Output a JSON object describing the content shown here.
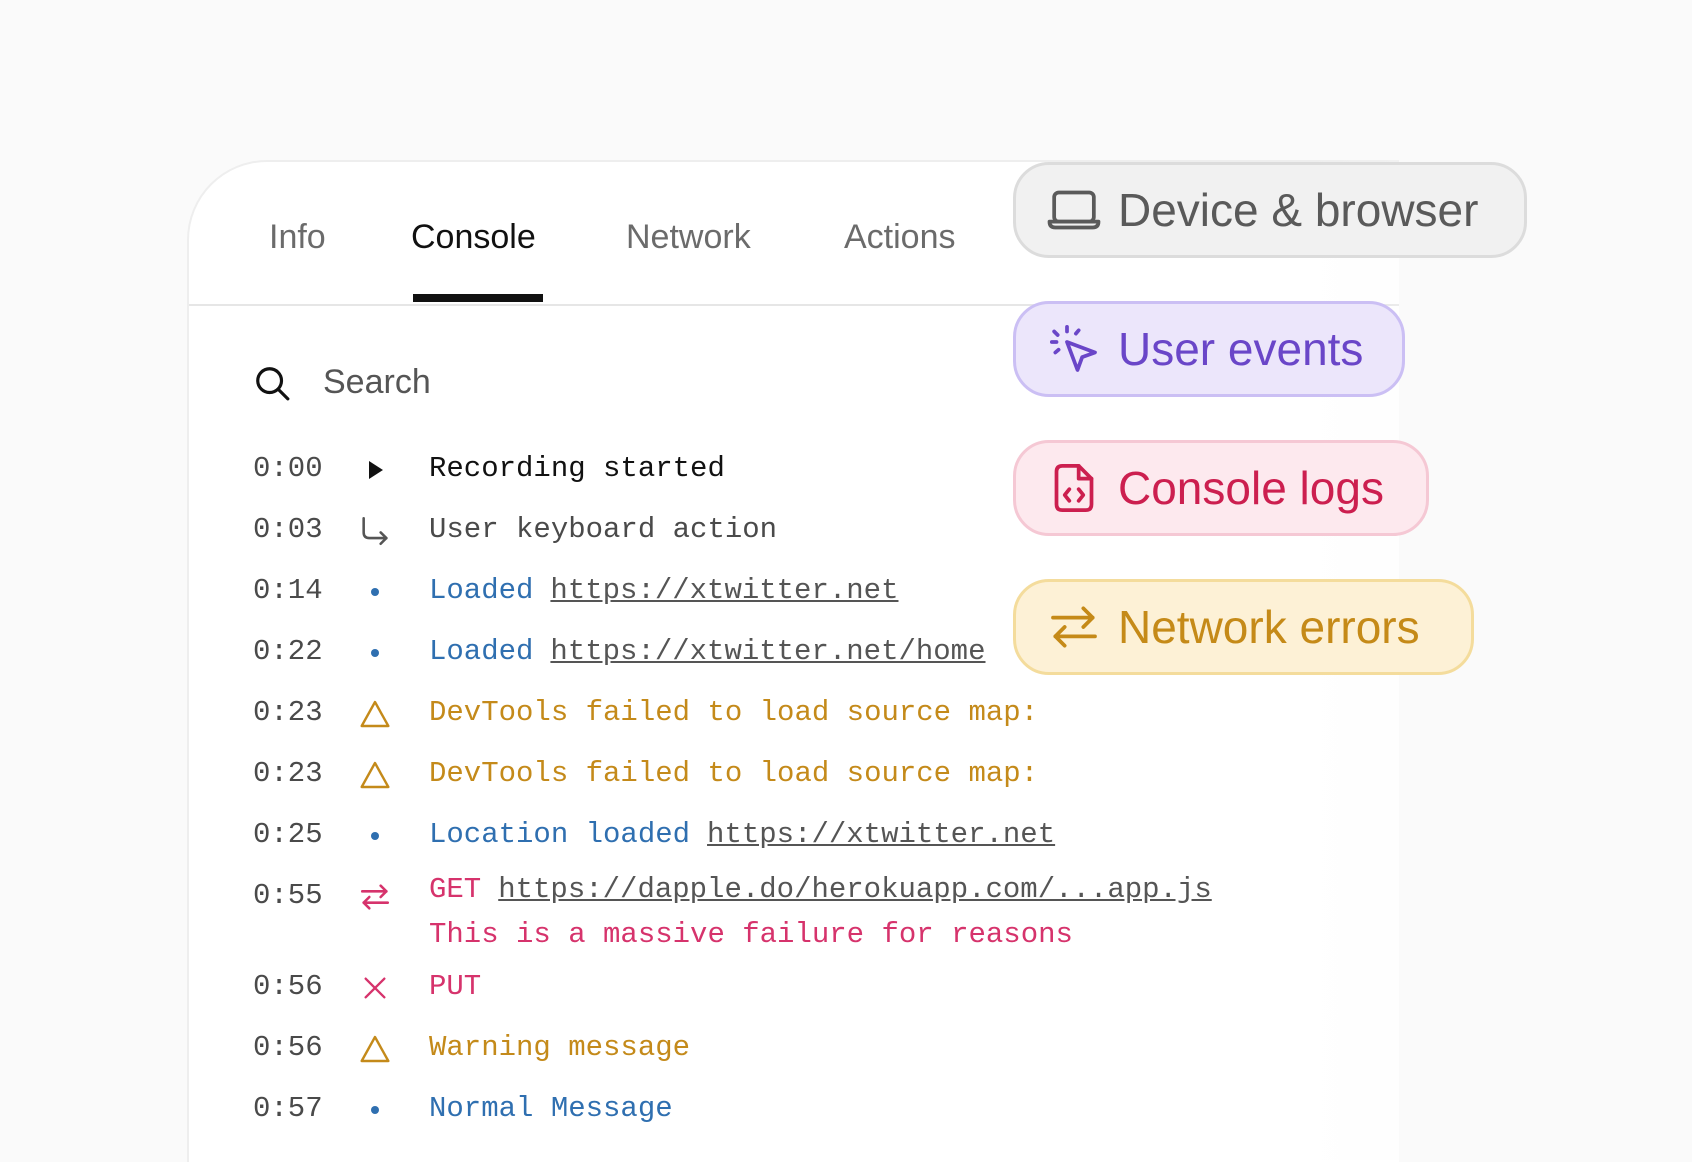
{
  "tabs": [
    {
      "label": "Info"
    },
    {
      "label": "Console"
    },
    {
      "label": "Network"
    },
    {
      "label": "Actions"
    }
  ],
  "active_tab": "Console",
  "search": {
    "placeholder": "Search",
    "value": ""
  },
  "logs": [
    {
      "time": "0:00",
      "icon": "play-icon",
      "text": "Recording started"
    },
    {
      "time": "0:03",
      "icon": "arrow-corner-icon",
      "text": "User keyboard action"
    },
    {
      "time": "0:14",
      "icon": "dot-icon",
      "text": "Loaded",
      "link": "https://xtwitter.net"
    },
    {
      "time": "0:22",
      "icon": "dot-icon",
      "text": "Loaded",
      "link": "https://xtwitter.net/home"
    },
    {
      "time": "0:23",
      "icon": "warning-icon",
      "text": "DevTools failed to load source map:"
    },
    {
      "time": "0:23",
      "icon": "warning-icon",
      "text": "DevTools failed to load source map:"
    },
    {
      "time": "0:25",
      "icon": "dot-icon",
      "text": "Location loaded",
      "link": "https://xtwitter.net"
    },
    {
      "time": "0:55",
      "icon": "swap-icon",
      "text": "GET",
      "link": "https://dapple.do/herokuapp.com/...app.js",
      "detail": "This is a massive failure for reasons"
    },
    {
      "time": "0:56",
      "icon": "x-icon",
      "text": "PUT"
    },
    {
      "time": "0:56",
      "icon": "warning-icon",
      "text": "Warning message"
    },
    {
      "time": "0:57",
      "icon": "dot-icon",
      "text": "Normal Message"
    }
  ],
  "pills": {
    "device": {
      "label": "Device & browser",
      "icon": "laptop-icon"
    },
    "user": {
      "label": "User events",
      "icon": "cursor-click-icon"
    },
    "console": {
      "label": "Console logs",
      "icon": "code-file-icon"
    },
    "network": {
      "label": "Network errors",
      "icon": "swap-icon"
    }
  },
  "colors": {
    "info_blue": "#2f6fb0",
    "warning_amber": "#c48a1a",
    "error_pink": "#d6336c",
    "user_purple": "#6a46c8",
    "console_red": "#cc1f4f"
  }
}
